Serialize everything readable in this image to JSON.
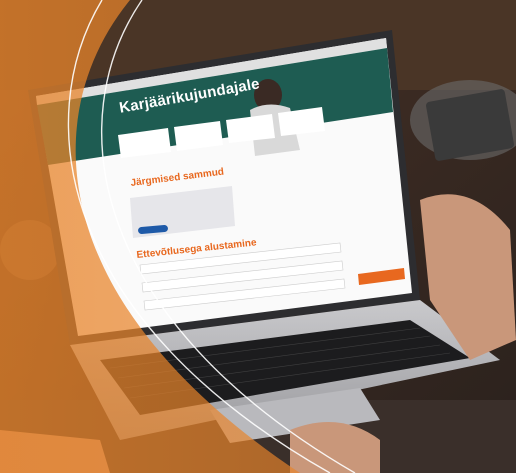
{
  "screen": {
    "hero_title": "Karjäärikujundajale",
    "tiles": [
      "",
      "",
      "",
      ""
    ],
    "section1_heading": "Järgmised sammud",
    "card_title": "",
    "card_button": "",
    "section2_heading": "Ettevõtlusega alustamine",
    "fields": [
      "",
      "",
      ""
    ]
  },
  "colors": {
    "banner_green": "#1e5c52",
    "accent_orange": "#e8681f",
    "button_blue": "#1e5aa8"
  }
}
